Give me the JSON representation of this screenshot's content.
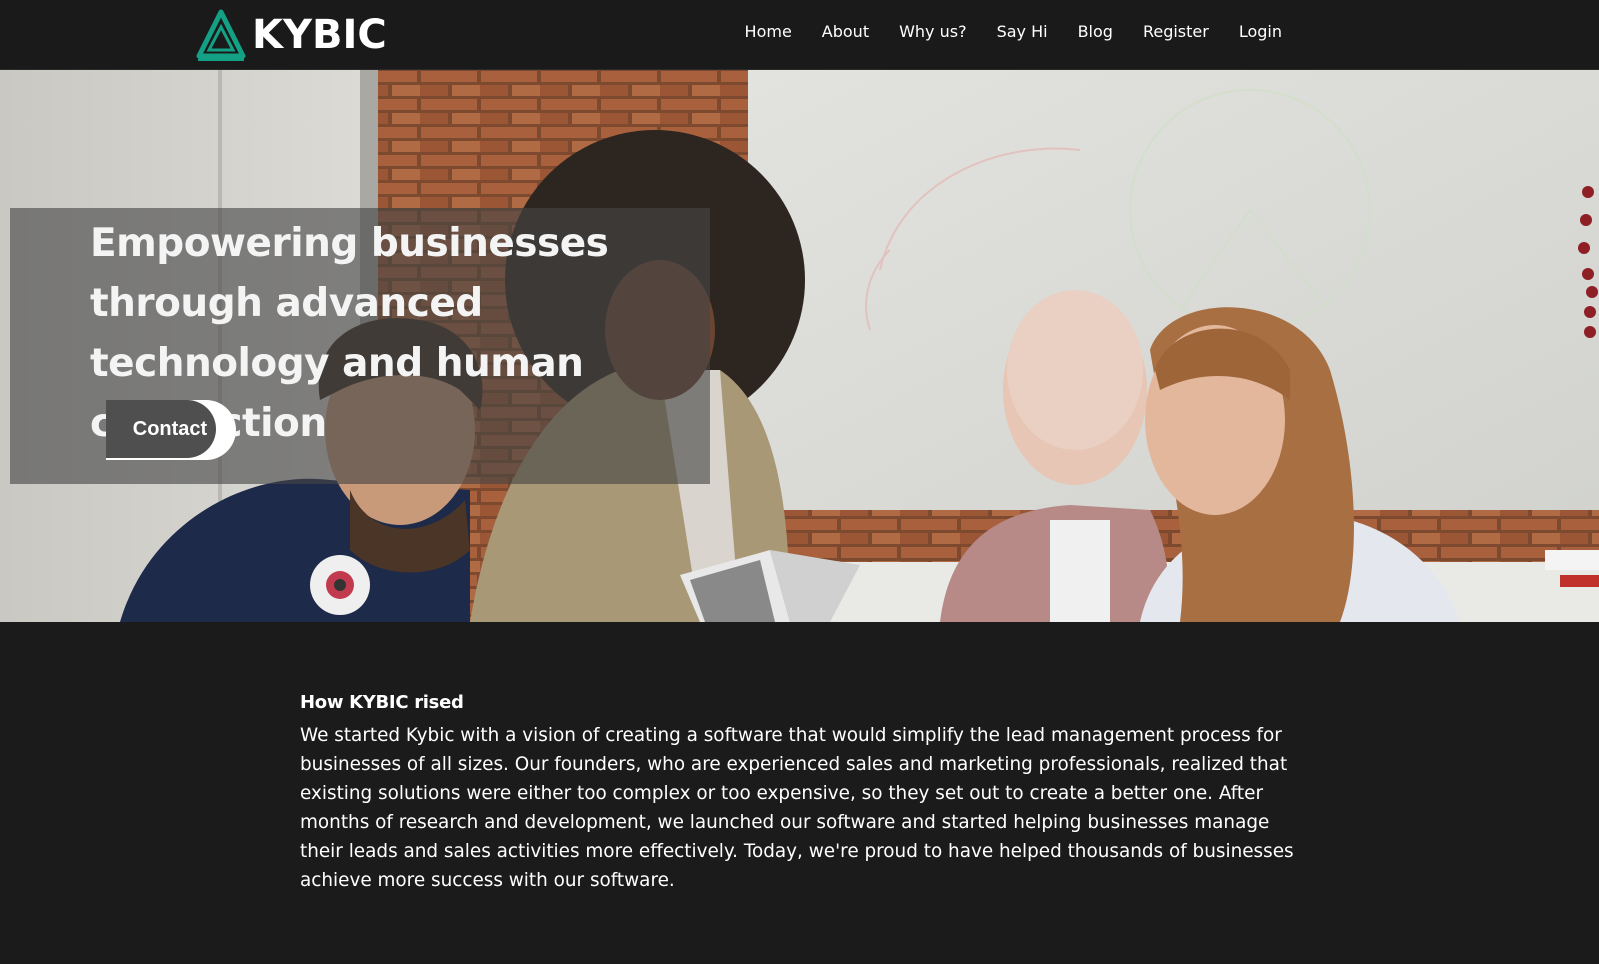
{
  "brand": {
    "name": "KYBIC",
    "logo_icon": "triangle-logo-icon",
    "accent": "#14a085"
  },
  "nav": {
    "items": [
      {
        "label": "Home"
      },
      {
        "label": "About"
      },
      {
        "label": "Why us?"
      },
      {
        "label": "Say Hi"
      },
      {
        "label": "Blog"
      },
      {
        "label": "Register"
      },
      {
        "label": "Login"
      }
    ]
  },
  "hero": {
    "title": "Empowering businesses through advanced technology and human connection",
    "cta_label": "Contact"
  },
  "story": {
    "heading": "How KYBIC rised",
    "body": "We started Kybic with a vision of creating a software that would simplify the lead management process for businesses of all sizes. Our founders, who are experienced sales and marketing professionals, realized that existing solutions were either too complex or too expensive, so they set out to create a better one. After months of research and development, we launched our software and started helping businesses manage their leads and sales activities more effectively. Today, we're proud to have helped thousands of businesses achieve more success with our software."
  },
  "colors": {
    "page_bg": "#1b1b1c",
    "nav_bg": "#1a1a1b",
    "text": "#ffffff"
  }
}
